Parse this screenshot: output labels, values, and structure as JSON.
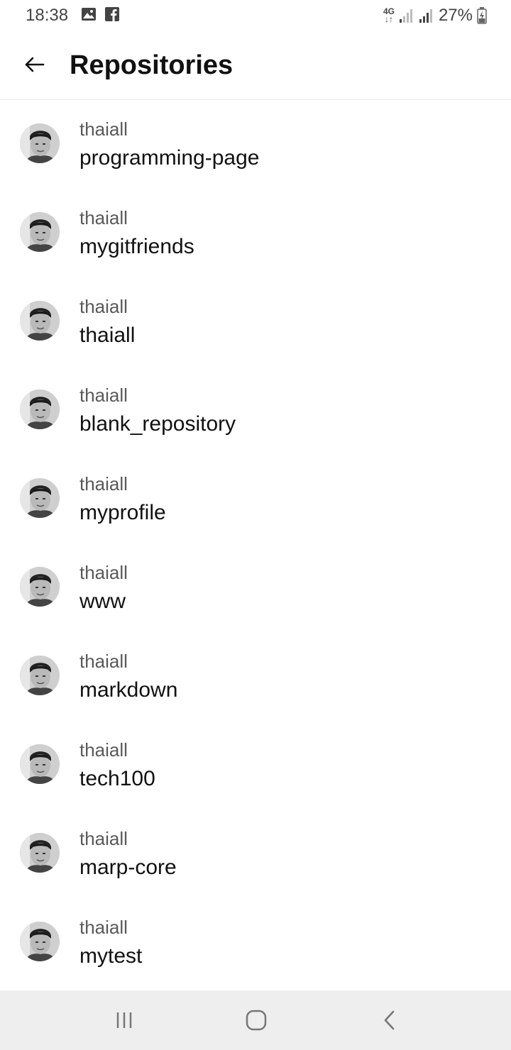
{
  "status_bar": {
    "time": "18:38",
    "left_icons": [
      "gallery-icon",
      "facebook-icon"
    ],
    "network_top": "4G",
    "network_bottom": "↓↑",
    "battery_percent": "27%"
  },
  "header": {
    "back_icon": "arrow-left-icon",
    "title": "Repositories"
  },
  "repositories": [
    {
      "owner": "thaiall",
      "name": "programming-page"
    },
    {
      "owner": "thaiall",
      "name": "mygitfriends"
    },
    {
      "owner": "thaiall",
      "name": "thaiall"
    },
    {
      "owner": "thaiall",
      "name": "blank_repository"
    },
    {
      "owner": "thaiall",
      "name": "myprofile"
    },
    {
      "owner": "thaiall",
      "name": "www"
    },
    {
      "owner": "thaiall",
      "name": "markdown"
    },
    {
      "owner": "thaiall",
      "name": "tech100"
    },
    {
      "owner": "thaiall",
      "name": "marp-core"
    },
    {
      "owner": "thaiall",
      "name": "mytest"
    }
  ],
  "nav_bar": {
    "icons": [
      "recent-apps-icon",
      "home-icon",
      "back-icon"
    ]
  },
  "colors": {
    "text_primary": "#111111",
    "text_secondary": "#595959",
    "nav_background": "#eeeeee"
  }
}
